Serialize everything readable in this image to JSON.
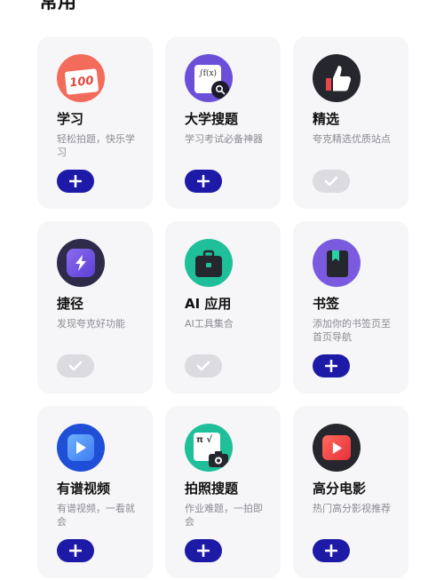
{
  "section_title": "常用",
  "cards": [
    {
      "title": "学习",
      "desc": "轻松拍题，快乐学习",
      "state": "add"
    },
    {
      "title": "大学搜题",
      "desc": "学习考试必备神器",
      "state": "add"
    },
    {
      "title": "精选",
      "desc": "夸克精选优质站点",
      "state": "added"
    },
    {
      "title": "捷径",
      "desc": "发现夸克好功能",
      "state": "added"
    },
    {
      "title": "AI 应用",
      "desc": "AI工具集合",
      "state": "added"
    },
    {
      "title": "书签",
      "desc": "添加你的书签页至首页导航",
      "state": "add"
    },
    {
      "title": "有谱视频",
      "desc": "有谱视频，一看就会",
      "state": "add"
    },
    {
      "title": "拍照搜题",
      "desc": "作业难题，一拍即会",
      "state": "add"
    },
    {
      "title": "高分电影",
      "desc": "热门高分影视推荐",
      "state": "add"
    }
  ],
  "icon_texts": {
    "study": "100",
    "formula": "∫f(x)",
    "math": "π √"
  },
  "icons": [
    "study-100-icon",
    "formula-search-icon",
    "thumbs-up-icon",
    "lightning-shortcut-icon",
    "toolbox-icon",
    "bookmark-icon",
    "play-video-icon",
    "camera-math-icon",
    "movie-play-icon"
  ],
  "colors": {
    "add_button": "#1d1aa8",
    "added_button": "#dcdce0",
    "card_bg": "#f6f6f8"
  }
}
